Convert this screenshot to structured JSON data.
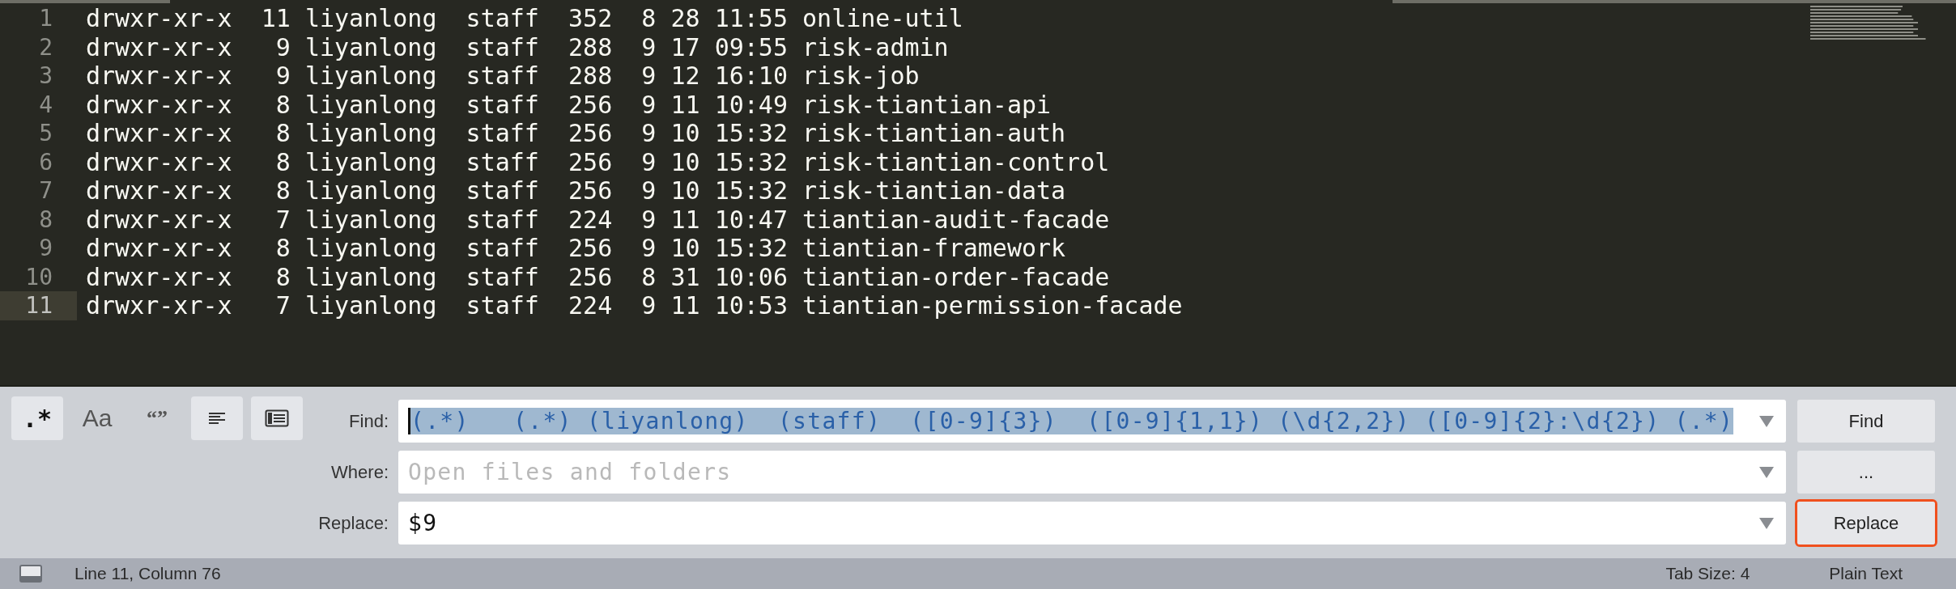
{
  "editor": {
    "lines": [
      {
        "number": "1",
        "text": "drwxr-xr-x  11 liyanlong  staff  352  8 28 11:55 online-util",
        "current": false
      },
      {
        "number": "2",
        "text": "drwxr-xr-x   9 liyanlong  staff  288  9 17 09:55 risk-admin",
        "current": false
      },
      {
        "number": "3",
        "text": "drwxr-xr-x   9 liyanlong  staff  288  9 12 16:10 risk-job",
        "current": false
      },
      {
        "number": "4",
        "text": "drwxr-xr-x   8 liyanlong  staff  256  9 11 10:49 risk-tiantian-api",
        "current": false
      },
      {
        "number": "5",
        "text": "drwxr-xr-x   8 liyanlong  staff  256  9 10 15:32 risk-tiantian-auth",
        "current": false
      },
      {
        "number": "6",
        "text": "drwxr-xr-x   8 liyanlong  staff  256  9 10 15:32 risk-tiantian-control",
        "current": false
      },
      {
        "number": "7",
        "text": "drwxr-xr-x   8 liyanlong  staff  256  9 10 15:32 risk-tiantian-data",
        "current": false
      },
      {
        "number": "8",
        "text": "drwxr-xr-x   7 liyanlong  staff  224  9 11 10:47 tiantian-audit-facade",
        "current": false
      },
      {
        "number": "9",
        "text": "drwxr-xr-x   8 liyanlong  staff  256  9 10 15:32 tiantian-framework",
        "current": false
      },
      {
        "number": "10",
        "text": "drwxr-xr-x   8 liyanlong  staff  256  8 31 10:06 tiantian-order-facade",
        "current": false
      },
      {
        "number": "11",
        "text": "drwxr-xr-x   7 liyanlong  staff  224  9 11 10:53 tiantian-permission-facade",
        "current": true
      }
    ]
  },
  "find_panel": {
    "toggles": [
      {
        "kind": "text",
        "label": ".*",
        "selected": true
      },
      {
        "kind": "text",
        "label": "Aa",
        "selected": false
      },
      {
        "kind": "text",
        "label": "“”",
        "selected": false
      },
      {
        "kind": "wrap",
        "selected": true
      },
      {
        "kind": "selection",
        "selected": true
      }
    ],
    "fields": [
      {
        "label": "Find:",
        "value": "(.*)   (.*) (liyanlong)  (staff)  ([0-9]{3})  ([0-9]{1,1}) (\\d{2,2}) ([0-9]{2}:\\d{2}) (.*)",
        "selected_text": true
      },
      {
        "label": "Where:",
        "placeholder": "Open files and folders",
        "selected_text": false
      },
      {
        "label": "Replace:",
        "value": "$9",
        "selected_text": false
      }
    ],
    "buttons": [
      {
        "label": "Find",
        "highlighted": false
      },
      {
        "label": "...",
        "highlighted": false
      },
      {
        "label": "Replace",
        "highlighted": true
      }
    ]
  },
  "status_bar": {
    "position": "Line 11, Column 76",
    "tab_size": "Tab Size: 4",
    "syntax": "Plain Text"
  }
}
